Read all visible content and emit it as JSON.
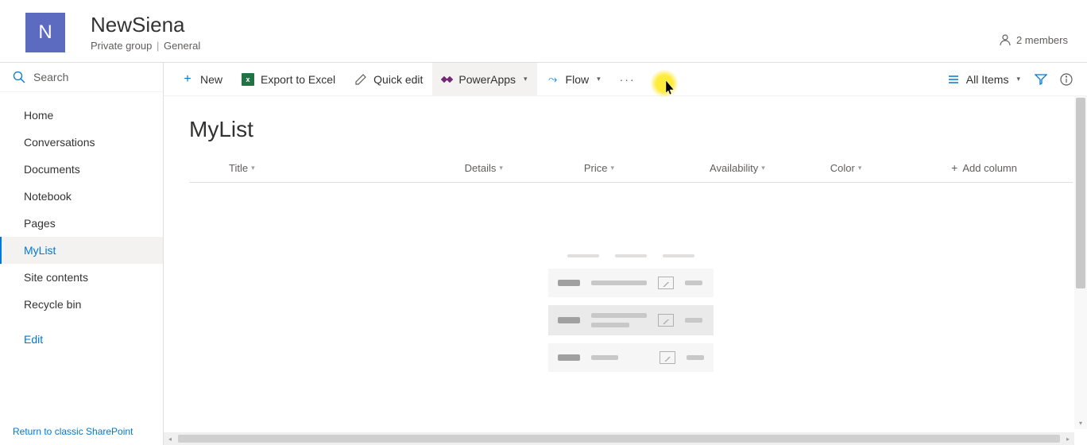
{
  "header": {
    "logo_letter": "N",
    "title": "NewSiena",
    "group_type": "Private group",
    "classification": "General",
    "members_text": "2 members"
  },
  "search": {
    "placeholder": "Search"
  },
  "nav": {
    "items": [
      "Home",
      "Conversations",
      "Documents",
      "Notebook",
      "Pages",
      "MyList",
      "Site contents",
      "Recycle bin"
    ],
    "edit_label": "Edit",
    "selected_index": 5,
    "return_link": "Return to classic SharePoint"
  },
  "toolbar": {
    "new": "New",
    "export": "Export to Excel",
    "quick_edit": "Quick edit",
    "powerapps": "PowerApps",
    "flow": "Flow",
    "view_label": "All Items"
  },
  "list": {
    "title": "MyList",
    "columns": [
      "Title",
      "Details",
      "Price",
      "Availability",
      "Color"
    ],
    "add_column": "Add column"
  }
}
